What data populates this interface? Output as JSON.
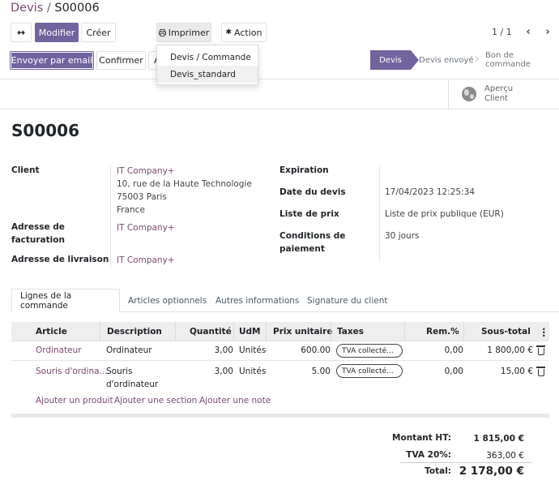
{
  "breadcrumb": {
    "parent": "Devis",
    "separator": " / ",
    "current": "S00006"
  },
  "toolbar": {
    "expand_icon": "↔",
    "modifier": "Modifier",
    "creer": "Créer",
    "imprimer_icon": "print-icon",
    "imprimer": "Imprimer",
    "action_icon": "gear-icon",
    "action": "Action"
  },
  "pager": {
    "text": "1 / 1",
    "prev": "‹",
    "next": "›"
  },
  "print_menu": [
    "Devis / Commande",
    "Devis_standard"
  ],
  "actions": {
    "envoyer": "Envoyer par email",
    "confirmer": "Confirmer",
    "partial": "A"
  },
  "statusbar": {
    "stages": [
      "Devis",
      "Devis envoyé",
      "Bon de commande"
    ],
    "active": "Devis"
  },
  "smart_button": {
    "line1": "Aperçu",
    "line2": "Client"
  },
  "record": {
    "name": "S00006"
  },
  "left_fields": {
    "client_label": "Client",
    "client_name": "IT Company+",
    "client_addr1": "10, rue de la Haute Technologie",
    "client_addr2": "75003 Paris",
    "client_addr3": "France",
    "facturation_label_1": "Adresse de",
    "facturation_label_2": "facturation",
    "facturation_value": "IT Company+",
    "livraison_label": "Adresse de livraison",
    "livraison_value": "IT Company+"
  },
  "right_fields": {
    "expiration_label": "Expiration",
    "expiration_value": "",
    "date_label": "Date du devis",
    "date_value": "17/04/2023 12:25:34",
    "prix_label": "Liste de prix",
    "prix_value": "Liste de prix publique (EUR)",
    "conditions_label_1": "Conditions de",
    "conditions_label_2": "paiement",
    "conditions_value": "30 jours"
  },
  "tabs": [
    "Lignes de la commande",
    "Articles optionnels",
    "Autres informations",
    "Signature du client"
  ],
  "table": {
    "headers": [
      "Article",
      "Description",
      "Quantité",
      "UdM",
      "Prix unitaire",
      "Taxes",
      "Rem.%",
      "Sous-total"
    ],
    "rows": [
      {
        "article": "Ordinateur",
        "description_1": "Ordinateur",
        "description_2": "",
        "quantite": "3,00",
        "udm": "Unités",
        "prix": "600.00",
        "taxe": "TVA collecté...",
        "remise": "0,00",
        "sous_total": "1 800,00 €"
      },
      {
        "article": "Souris d'ordina...",
        "description_1": "Souris",
        "description_2": "d'ordinateur",
        "quantite": "3,00",
        "udm": "Unités",
        "prix": "5.00",
        "taxe": "TVA collecté...",
        "remise": "0,00",
        "sous_total": "15,00 €"
      }
    ],
    "add_product": "Ajouter un produit",
    "add_section": "Ajouter une section",
    "add_note": "Ajouter une note"
  },
  "totals": {
    "ht_label": "Montant HT:",
    "ht_value": "1 815,00 €",
    "tva_label": "TVA 20%:",
    "tva_value": "363,00 €",
    "total_label": "Total:",
    "total_value": "2 178,00 €"
  },
  "colors": {
    "primary": "#71639e",
    "link": "#7b4a73"
  }
}
